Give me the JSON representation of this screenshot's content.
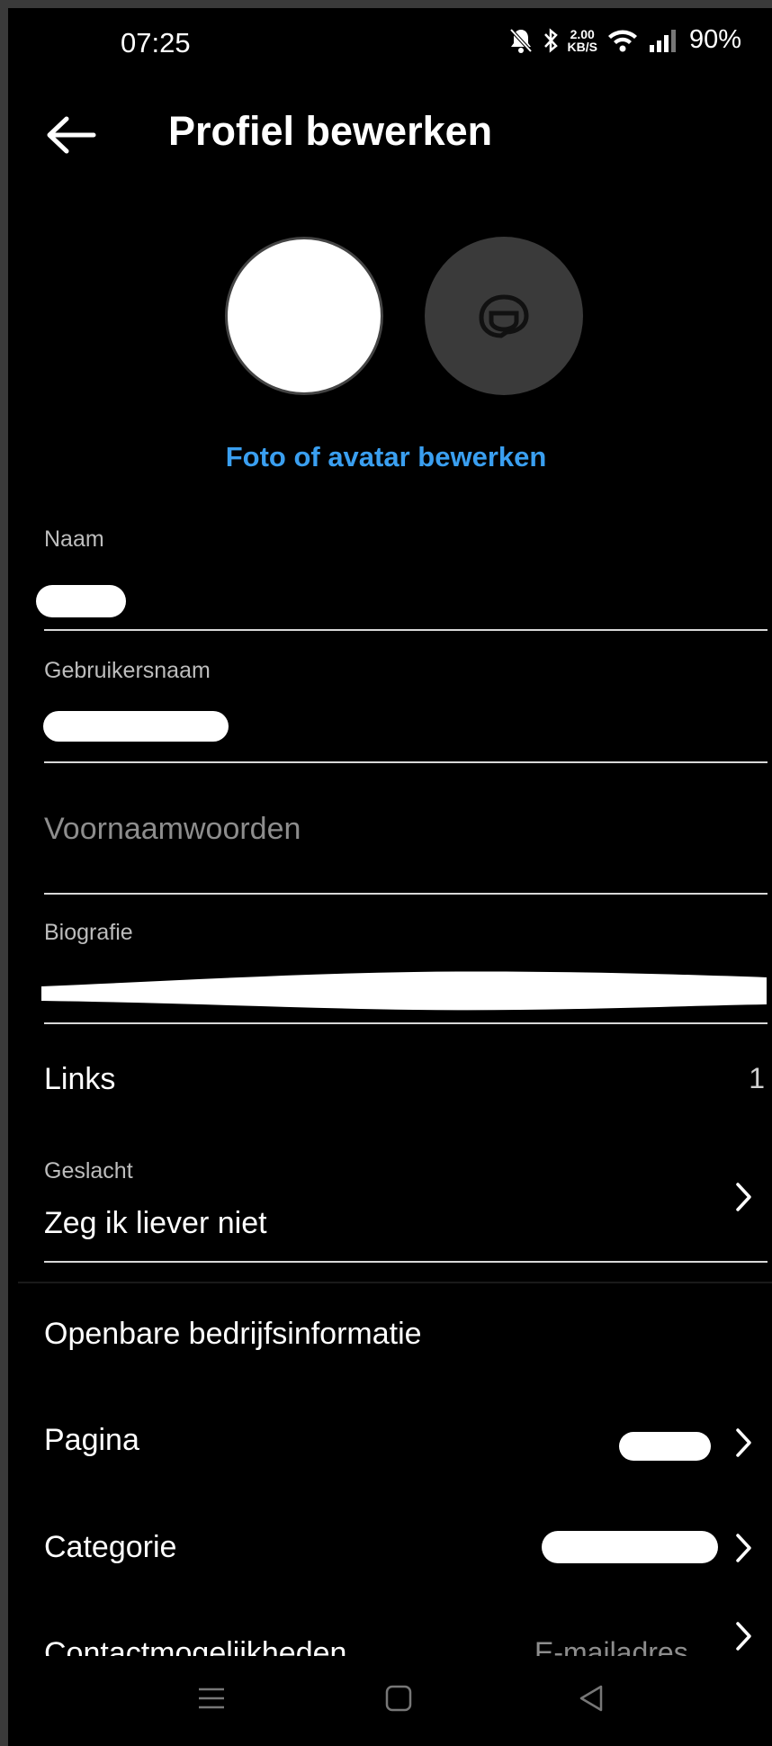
{
  "status_bar": {
    "time": "07:25",
    "net_speed_value": "2.00",
    "net_speed_unit": "KB/S",
    "battery": "90%",
    "icons": [
      "bell-off-icon",
      "bluetooth-icon",
      "wifi-icon",
      "signal-icon"
    ]
  },
  "header": {
    "title": "Profiel bewerken",
    "back_icon": "arrow-left-icon"
  },
  "profile": {
    "edit_label": "Foto of avatar bewerken",
    "avatar_icon": "avatar-face-icon"
  },
  "fields": {
    "name_label": "Naam",
    "username_label": "Gebruikersnaam",
    "pronouns_placeholder": "Voornaamwoorden",
    "bio_label": "Biografie",
    "links_label": "Links",
    "links_count": "1",
    "gender_label": "Geslacht",
    "gender_value": "Zeg ik liever niet"
  },
  "business": {
    "section_title": "Openbare bedrijfsinformatie",
    "page_label": "Pagina",
    "category_label": "Categorie",
    "contact_label": "Contactmogelijkheden",
    "contact_value": "E-mailadres"
  },
  "colors": {
    "background": "#000000",
    "accent": "#3a9ff0",
    "divider": "#d8d8d8",
    "muted": "#8d8d8d"
  }
}
